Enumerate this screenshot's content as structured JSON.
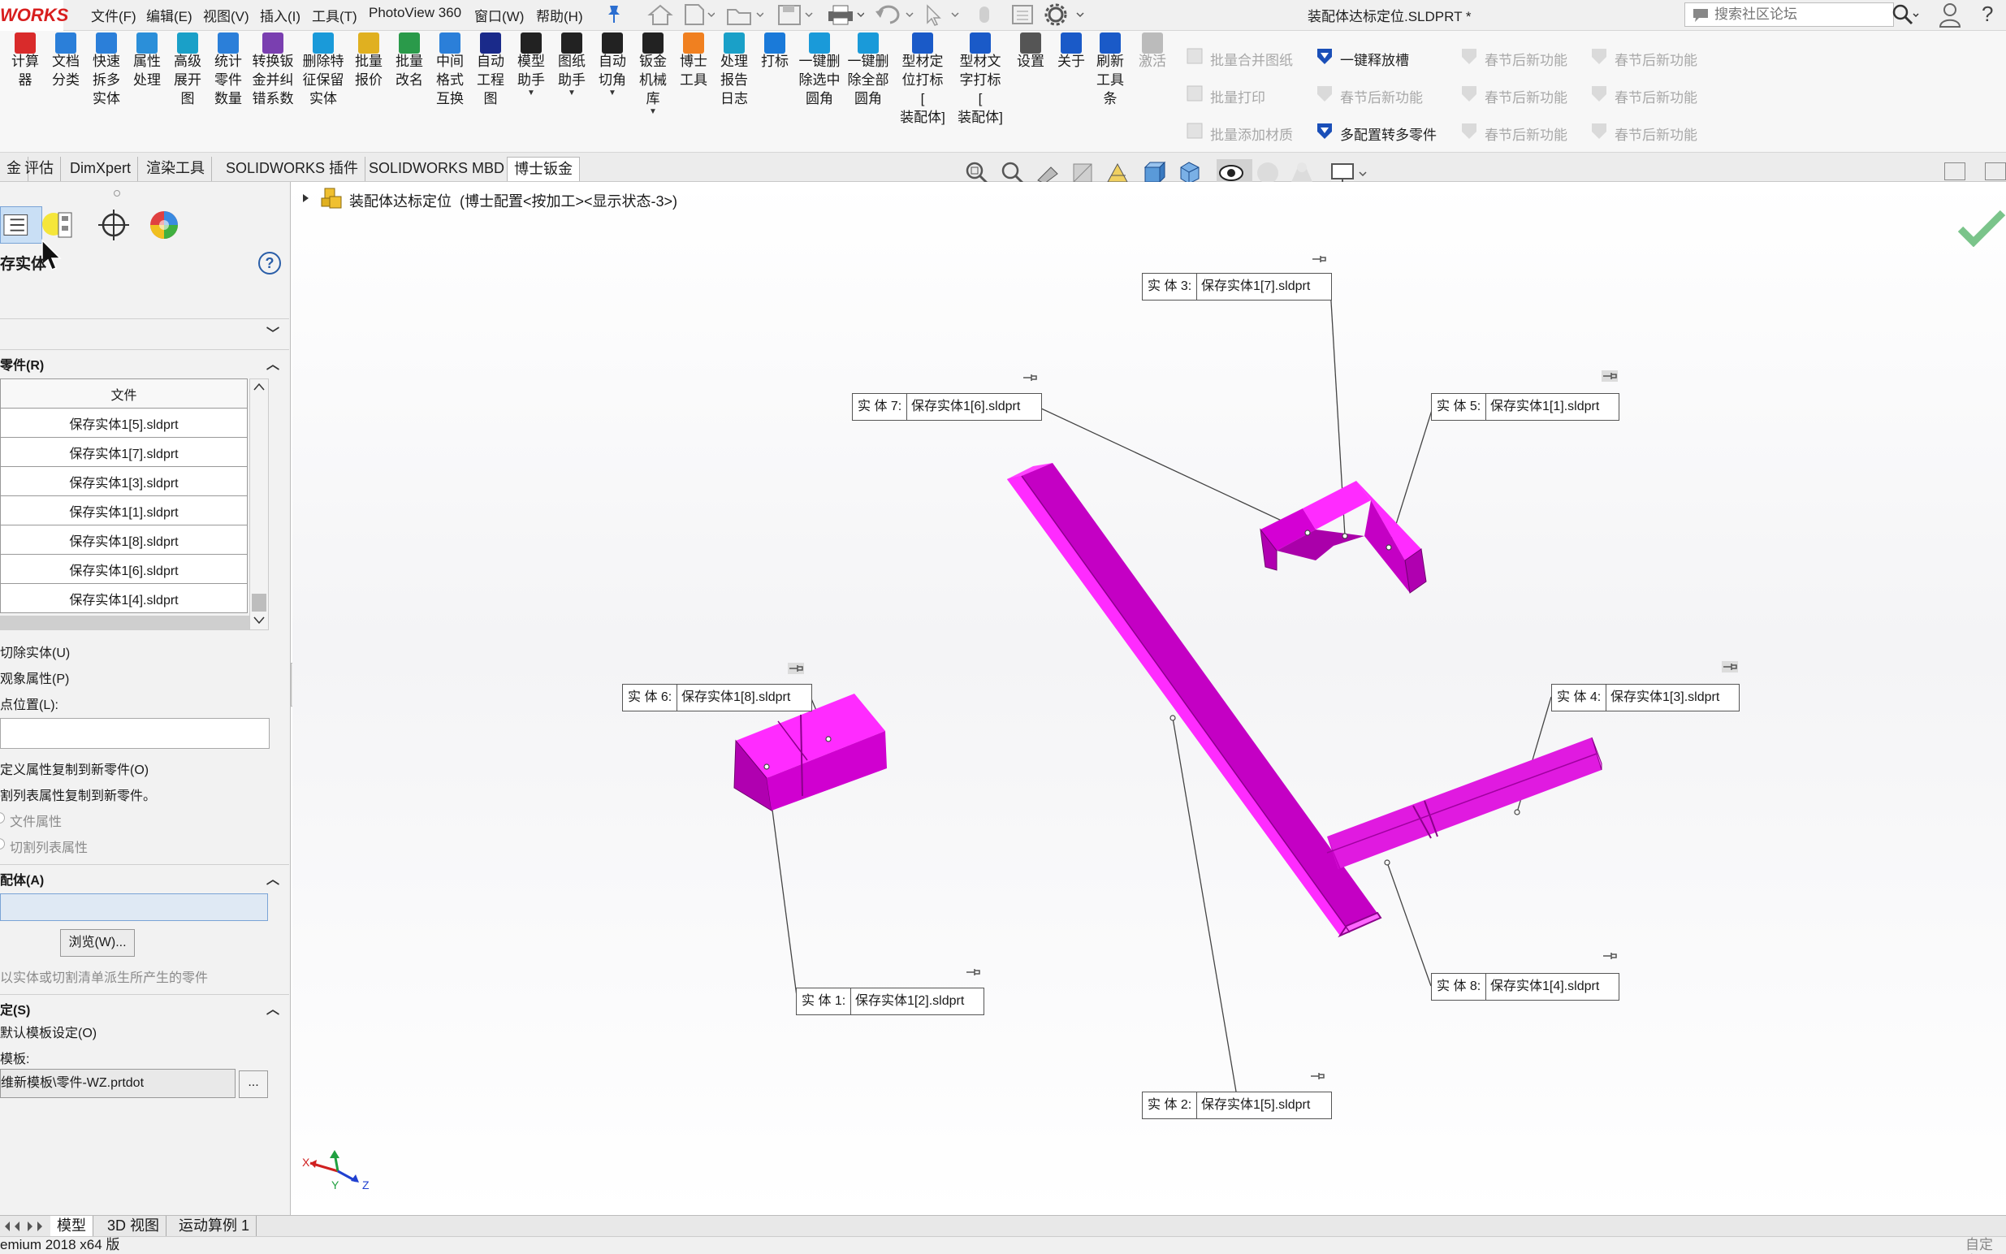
{
  "app": {
    "logo_text": "WORKS",
    "document_title": "装配体达标定位.SLDPRT *"
  },
  "menu": {
    "items": [
      "文件(F)",
      "编辑(E)",
      "视图(V)",
      "插入(I)",
      "工具(T)",
      "PhotoView 360",
      "窗口(W)",
      "帮助(H)"
    ]
  },
  "search": {
    "placeholder": "搜索社区论坛"
  },
  "ribbon": {
    "tools": [
      {
        "label": "计算\n器",
        "color": "#d92b2b"
      },
      {
        "label": "文档\n分类",
        "color": "#2b7fd9"
      },
      {
        "label": "快速\n拆多\n实体",
        "color": "#2b7fd9"
      },
      {
        "label": "属性\n处理",
        "color": "#2b8fd9"
      },
      {
        "label": "高级\n展开\n图",
        "color": "#1aa0c8"
      },
      {
        "label": "统计\n零件\n数量",
        "color": "#2b7fd9"
      },
      {
        "label": "转换钣\n金并纠\n错系数",
        "color": "#7a3fb0"
      },
      {
        "label": "删除特\n征保留\n实体",
        "color": "#1a9ad9"
      },
      {
        "label": "批量\n报价",
        "color": "#e0b020"
      },
      {
        "label": "批量\n改名",
        "color": "#2a9a4a"
      },
      {
        "label": "中间\n格式\n互换",
        "color": "#2b7fd9"
      },
      {
        "label": "自动\n工程\n图",
        "color": "#1a2a8a"
      },
      {
        "label": "模型\n助手",
        "color": "#222222"
      },
      {
        "label": "图纸\n助手",
        "color": "#222222"
      },
      {
        "label": "自动\n切角",
        "color": "#222222"
      },
      {
        "label": "钣金\n机械\n库",
        "color": "#222222"
      },
      {
        "label": "博士\n工具",
        "color": "#f08020"
      },
      {
        "label": "处理\n报告\n日志",
        "color": "#1aa0c8"
      },
      {
        "label": "打标",
        "color": "#1a7ad9"
      },
      {
        "label": "一键删\n除选中\n圆角",
        "color": "#1a9ad9"
      },
      {
        "label": "一键删\n除全部\n圆角",
        "color": "#1a9ad9"
      },
      {
        "label": "型材定\n位打标 [\n装配体]",
        "color": "#1a5ac8"
      },
      {
        "label": "型材文\n字打标 [\n装配体]",
        "color": "#1a5ac8"
      },
      {
        "label": "设置",
        "color": "#555555"
      },
      {
        "label": "关于",
        "color": "#1a5ac8"
      },
      {
        "label": "刷新\n工具\n条",
        "color": "#1a5ac8"
      },
      {
        "label": "激活",
        "color": "#bbbbbb"
      }
    ],
    "group_col1": [
      "批量合并图纸",
      "批量打印",
      "批量添加材质"
    ],
    "group_col2": [
      "一键释放槽",
      "春节后新功能",
      "多配置转多零件"
    ],
    "group_col3": [
      "春节后新功能",
      "春节后新功能",
      "春节后新功能"
    ],
    "group_col4": [
      "春节后新功能",
      "春节后新功能",
      "春节后新功能"
    ]
  },
  "tabs": [
    "金",
    "评估",
    "DimXpert",
    "渲染工具",
    "SOLIDWORKS 插件",
    "SOLIDWORKS MBD",
    "博士钣金"
  ],
  "panel": {
    "title": "存实体",
    "section_parts": "零件(R)",
    "table_header": "文件",
    "table_rows": [
      "保存实体1[5].sldprt",
      "保存实体1[7].sldprt",
      "保存实体1[3].sldprt",
      "保存实体1[1].sldprt",
      "保存实体1[8].sldprt",
      "保存实体1[6].sldprt",
      "保存实体1[4].sldprt"
    ],
    "opt_cut": "切除实体(U)",
    "opt_appearance": "观象属性(P)",
    "opt_vertex": "点位置(L):",
    "opt_copy_custom": "定义属性复制到新零件(O)",
    "opt_copy_cutlist": "割列表属性复制到新零件。",
    "opt_file_props": "文件属性",
    "opt_cutlist_props": "切割列表属性",
    "section_assembly": "配体(A)",
    "browse_label": "浏览(W)...",
    "assembly_hint": "以实体或切割清单派生所产生的零件",
    "section_settings": "定(S)",
    "opt_default_template": "默认模板设定(O)",
    "template_label": "模板:",
    "template_value": "维新模板\\零件-WZ.prtdot",
    "template_btn": "..."
  },
  "tree": {
    "root_label": "装配体达标定位",
    "root_config": "(博士配置<按加工><显示状态-3>)"
  },
  "callouts": [
    {
      "key": "实 体  3:",
      "value": "保存实体1[7].sldprt"
    },
    {
      "key": "实 体  7:",
      "value": "保存实体1[6].sldprt"
    },
    {
      "key": "实 体  5:",
      "value": "保存实体1[1].sldprt"
    },
    {
      "key": "实 体  6:",
      "value": "保存实体1[8].sldprt"
    },
    {
      "key": "实 体  4:",
      "value": "保存实体1[3].sldprt"
    },
    {
      "key": "实 体  1:",
      "value": "保存实体1[2].sldprt"
    },
    {
      "key": "实 体  8:",
      "value": "保存实体1[4].sldprt"
    },
    {
      "key": "实 体  2:",
      "value": "保存实体1[5].sldprt"
    }
  ],
  "bottom_tabs": [
    "模型",
    "3D 视图",
    "运动算例 1"
  ],
  "status": {
    "left": "emium 2018 x64 版",
    "right": "自定义"
  },
  "colors": {
    "part_magenta": "#ff1aff",
    "part_dark": "#b000b0",
    "accent_blue": "#1a5ac8"
  }
}
